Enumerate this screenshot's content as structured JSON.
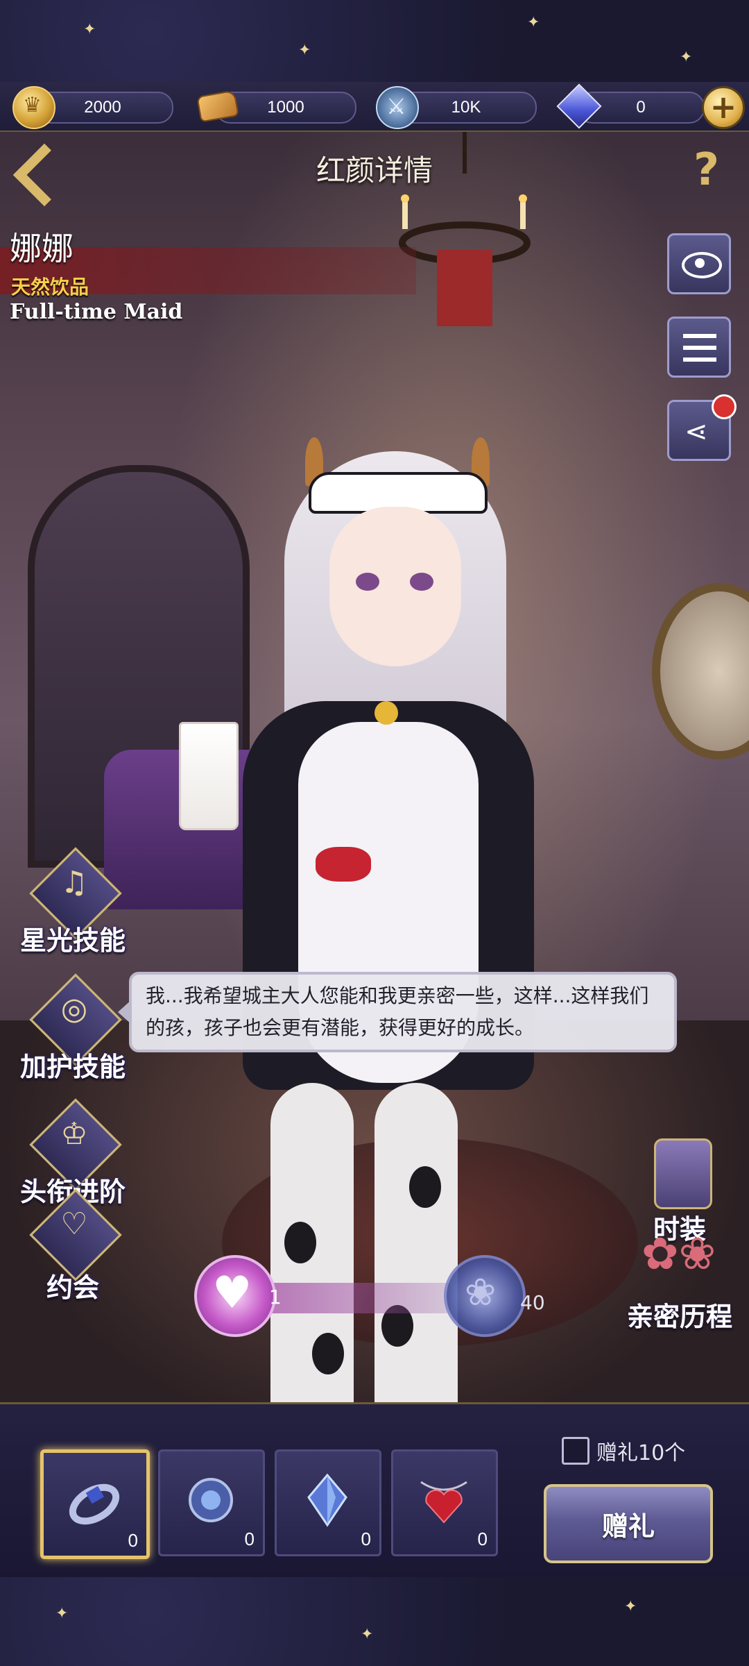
{
  "resources": [
    {
      "icon": "gold-coin-icon",
      "value": "2000"
    },
    {
      "icon": "bread-icon",
      "value": "1000"
    },
    {
      "icon": "sword-icon",
      "value": "10K"
    },
    {
      "icon": "gem-icon",
      "value": "0"
    }
  ],
  "header": {
    "title": "红颜详情"
  },
  "character": {
    "name": "娜娜",
    "subtitle": "天然饮品",
    "title_en": "Full-time Maid"
  },
  "left_menu": [
    {
      "label": "星光技能",
      "icon": "music-note-icon"
    },
    {
      "label": "加护技能",
      "icon": "halo-wings-icon"
    },
    {
      "label": "头衔进阶",
      "icon": "crown-icon"
    },
    {
      "label": "约会",
      "icon": "heart-icon"
    }
  ],
  "right_menu": [
    {
      "label": "时装",
      "icon": "costume-icon"
    },
    {
      "label": "亲密历程",
      "icon": "roses-icon"
    }
  ],
  "dialog": {
    "text": "我...我希望城主大人您能和我更亲密一些，这样...这样我们的孩，孩子也会更有潜能，获得更好的成长。"
  },
  "counters": {
    "affection": "1",
    "roses": "40"
  },
  "gifts": [
    {
      "icon": "ring-gift-icon",
      "count": "0"
    },
    {
      "icon": "gem-brooch-gift-icon",
      "count": "0"
    },
    {
      "icon": "crystal-gift-icon",
      "count": "0"
    },
    {
      "icon": "heart-necklace-gift-icon",
      "count": "0"
    }
  ],
  "gift_controls": {
    "bulk_label": "赠礼10个",
    "gift_button": "赠礼"
  },
  "colors": {
    "accent_gold": "#d9b96a",
    "name_band": "#781e23",
    "subtitle_yellow": "#f6cf4a"
  }
}
